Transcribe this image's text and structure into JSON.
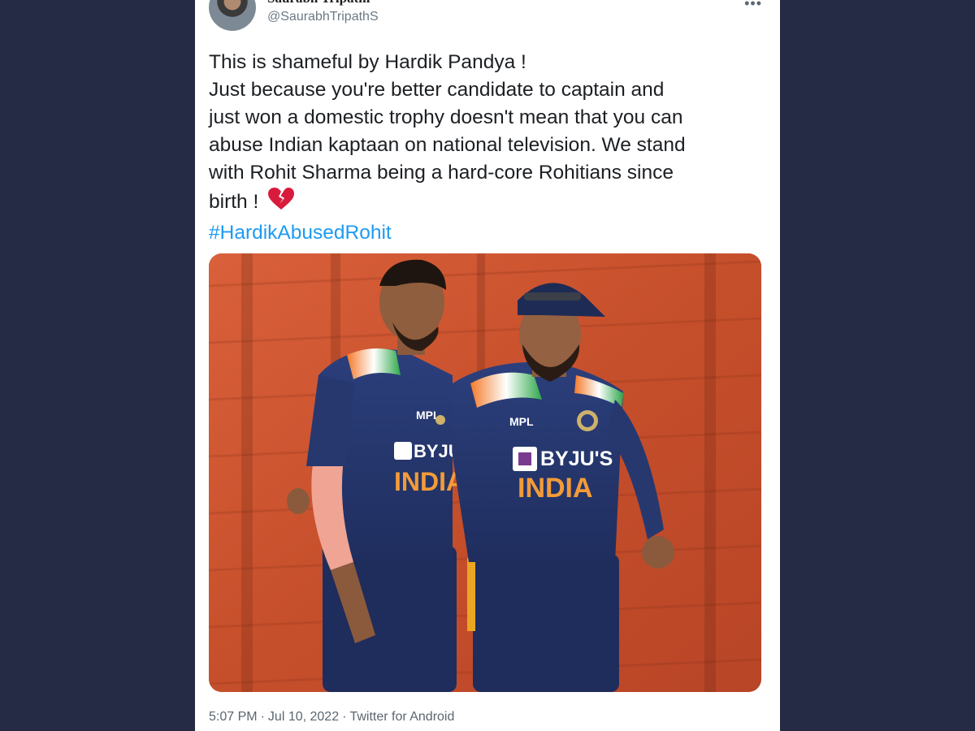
{
  "author": {
    "display_name": "Saurabh Tripathi",
    "handle": "@SaurabhTripathS"
  },
  "icons": {
    "more": "more-options-icon",
    "avatar": "profile-avatar",
    "emoji": "broken-heart-emoji"
  },
  "tweet": {
    "lines": [
      "This is shameful by Hardik Pandya !",
      "Just because you're better candidate to captain and",
      "just won a domestic trophy doesn't mean that you can",
      "abuse Indian kaptaan on national television. We stand",
      "with Rohit Sharma being a hard-core Rohitians since",
      "birth !"
    ],
    "hashtag": "#HardikAbusedRohit"
  },
  "photo": {
    "jersey_texts": {
      "left_sponsor": "BYJU'S",
      "left_country": "INDIA",
      "left_brand": "MPL",
      "right_sponsor": "BYJU'S",
      "right_country": "INDIA",
      "right_brand": "MPL"
    }
  },
  "meta": {
    "time": "5:07 PM",
    "separator": "·",
    "date": "Jul 10, 2022",
    "source": "Twitter for Android"
  },
  "colors": {
    "background": "#252b44",
    "hashtag": "#1d9bf0",
    "jersey": "#24366e",
    "stands": "#c8552e"
  }
}
